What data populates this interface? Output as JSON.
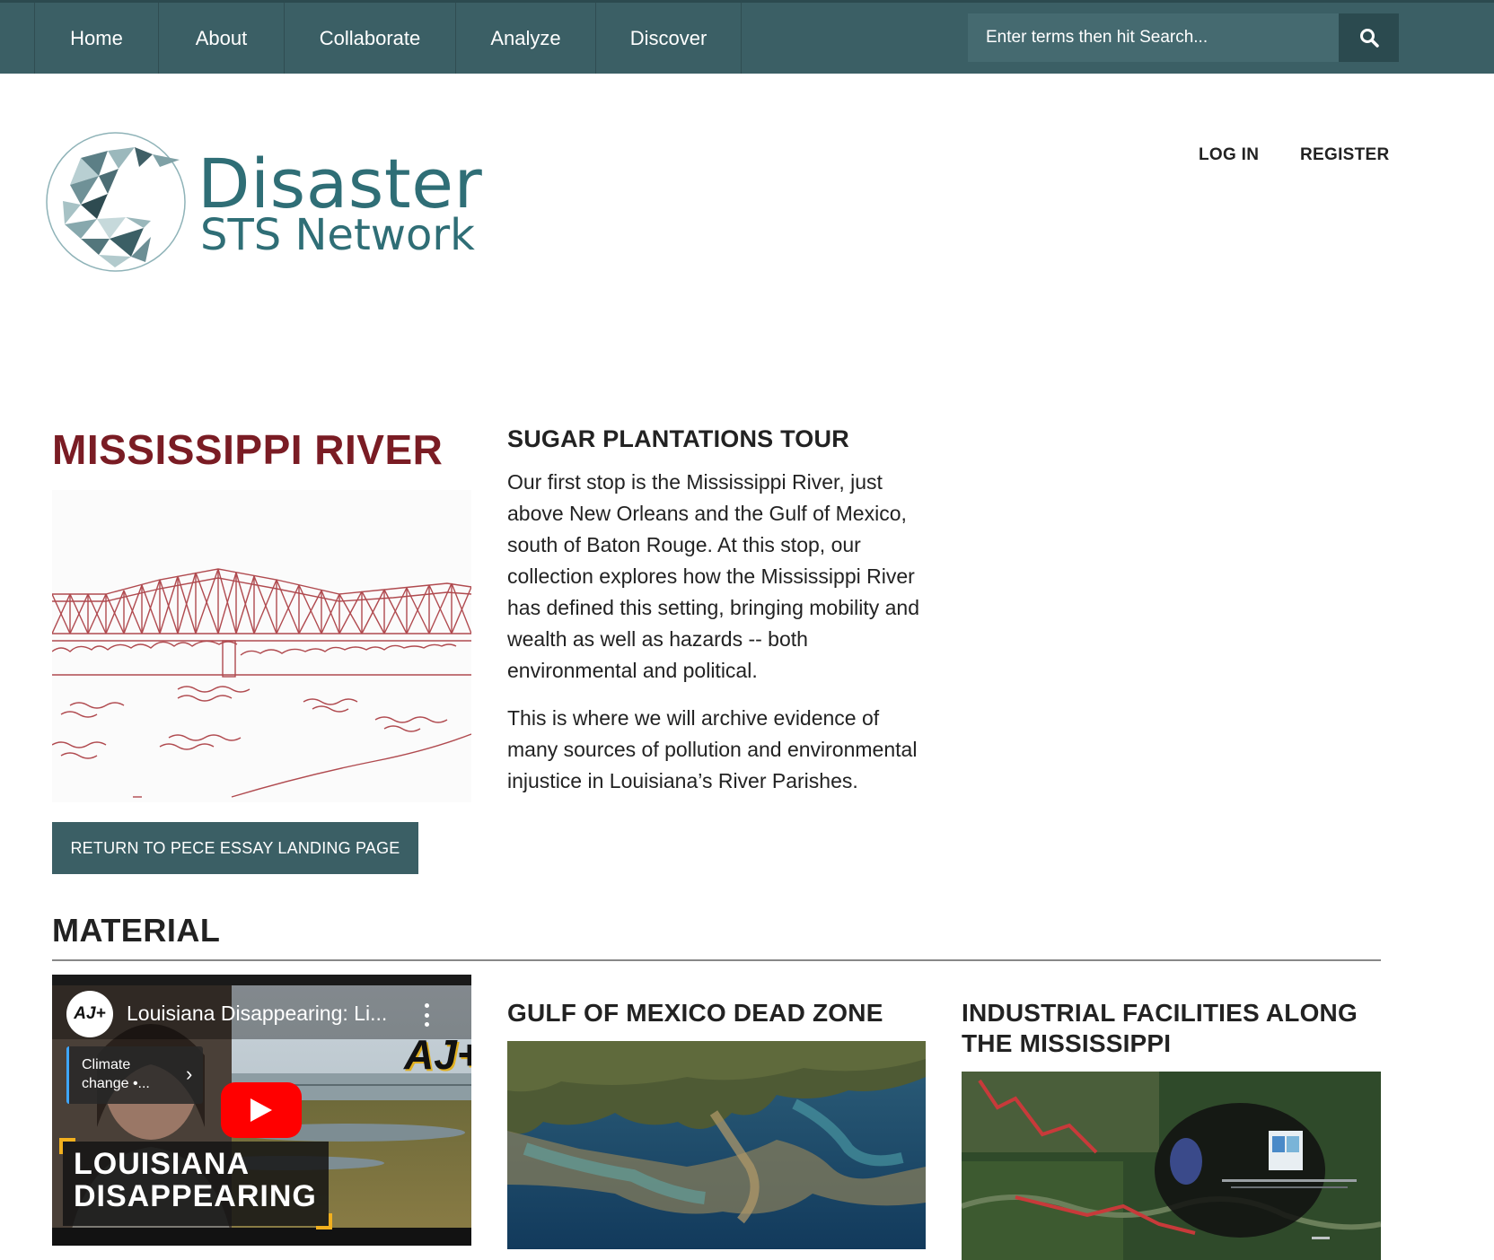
{
  "nav": {
    "items": [
      {
        "label": "Home"
      },
      {
        "label": "About"
      },
      {
        "label": "Collaborate"
      },
      {
        "label": "Analyze"
      },
      {
        "label": "Discover"
      }
    ],
    "search_placeholder": "Enter terms then hit Search...",
    "search_icon": "search-icon"
  },
  "logo": {
    "title": "Disaster",
    "subtitle": "STS Network"
  },
  "auth": {
    "login": "LOG IN",
    "register": "REGISTER"
  },
  "page": {
    "title": "MISSISSIPPI RIVER",
    "return_button": "RETURN TO PECE ESSAY LANDING PAGE"
  },
  "tour": {
    "title": "SUGAR PLANTATIONS TOUR",
    "paragraphs": [
      "Our first stop is the Mississippi River, just above New Orleans and the Gulf of Mexico, south of Baton Rouge.  At this stop, our collection explores how the Mississippi River has defined this setting, bringing mobility and wealth as well as hazards -- both environmental and political.",
      "This is where we will archive evidence of many sources of pollution and environmental injustice in Louisiana’s River Parishes."
    ]
  },
  "material": {
    "heading": "MATERIAL",
    "video": {
      "channel_logo": "AJ+",
      "title": "Louisiana Disappearing: Li...",
      "chip": "Climate change •...",
      "banner_line1": "LOUISIANA",
      "banner_line2": "DISAPPEARING"
    },
    "cards": [
      {
        "title": "GULF OF MEXICO DEAD ZONE"
      },
      {
        "title": "INDUSTRIAL FACILITIES ALONG THE MISSISSIPPI"
      }
    ]
  },
  "colors": {
    "nav_bg": "#3b5f65",
    "accent_red": "#7a1c24",
    "logo_teal": "#2f6e76"
  }
}
